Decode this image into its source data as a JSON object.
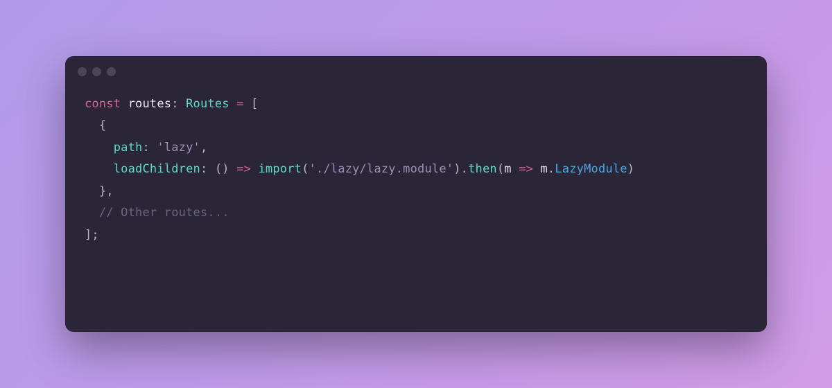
{
  "code": {
    "line1": {
      "const": "const",
      "routes": " routes",
      "colon": ": ",
      "type": "Routes",
      "equals": " = ",
      "bracket": "["
    },
    "line2": {
      "indent": "  ",
      "brace": "{"
    },
    "line3": {
      "indent": "    ",
      "path": "path",
      "colon": ": ",
      "value": "'lazy'",
      "comma": ","
    },
    "line4": {
      "indent": "    ",
      "loadChildren": "loadChildren",
      "colon": ": ",
      "parens1": "() ",
      "arrow": "=>",
      "space1": " ",
      "import": "import",
      "lparen": "(",
      "module": "'./lazy/lazy.module'",
      "rparen": ")",
      "dot": ".",
      "then": "then",
      "lparen2": "(",
      "m": "m ",
      "arrow2": "=>",
      "m2": " m",
      "dot2": ".",
      "class": "LazyModule",
      "rparen2": ")"
    },
    "line5": {
      "indent": "  ",
      "brace": "},"
    },
    "line6": {
      "indent": "  ",
      "comment": "// Other routes..."
    },
    "line7": {
      "close": "];"
    }
  }
}
